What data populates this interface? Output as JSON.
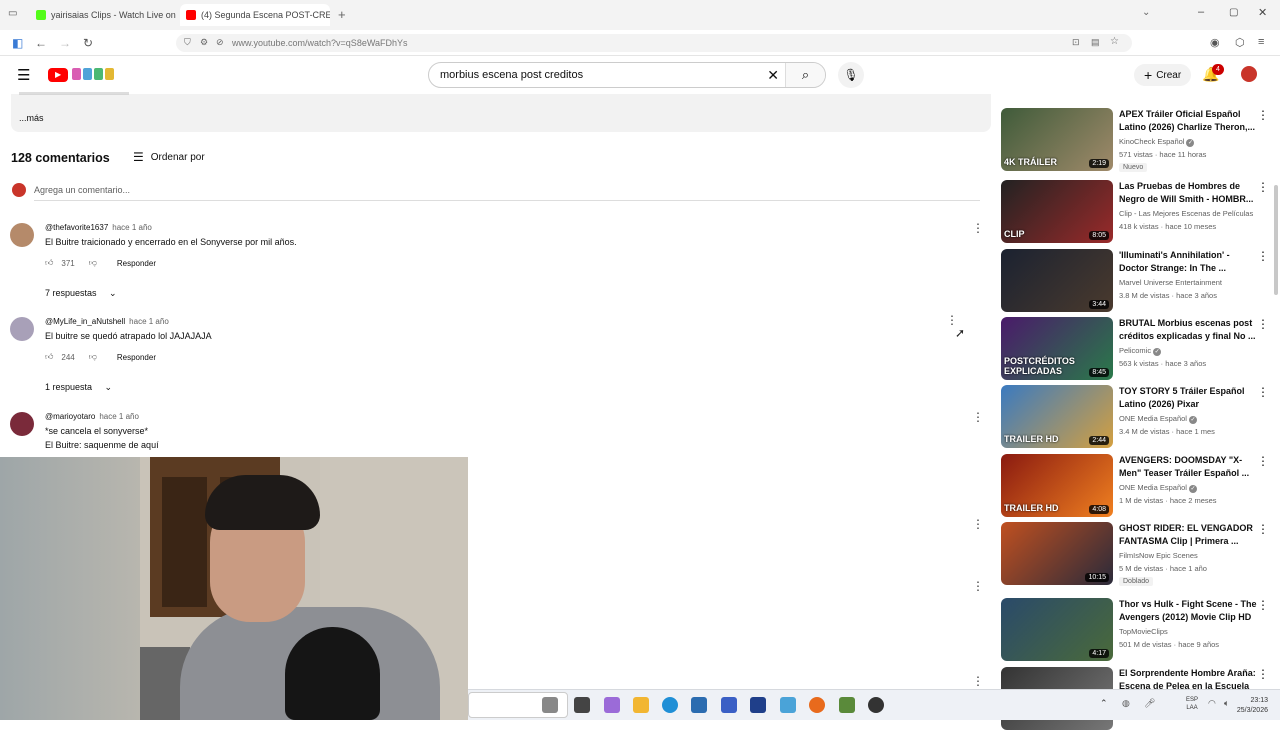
{
  "browser": {
    "tabs": [
      {
        "title": "yairisaias Clips - Watch Live on",
        "active": false,
        "favicon_color": "#53fc18"
      },
      {
        "title": "(4) Segunda Escena POST-CRED",
        "active": true,
        "favicon_color": "#ff0000"
      }
    ],
    "url": "www.youtube.com/watch?v=qS8eWaFDhYs"
  },
  "youtube": {
    "search_query": "morbius escena post creditos",
    "create_label": "Crear",
    "notifications_count": "4"
  },
  "description": {
    "more_label": "...más"
  },
  "comments_header": {
    "count_label": "128 comentarios",
    "sort_label": "Ordenar por",
    "add_placeholder": "Agrega un comentario..."
  },
  "comments": [
    {
      "handle": "@thefavorite1637",
      "ago": "hace 1 año",
      "text": "El Buitre traicionado y encerrado en el Sonyverse por mil años.",
      "likes": "371",
      "reply_label": "Responder",
      "replies_label": "7 respuestas"
    },
    {
      "handle": "@MyLife_in_aNutshell",
      "ago": "hace 1 año",
      "text": "El buitre se quedó atrapado lol JAJAJAJA",
      "likes": "244",
      "reply_label": "Responder",
      "replies_label": "1 respuesta"
    },
    {
      "handle": "@marioyotaro",
      "ago": "hace 1 año",
      "text": "*se cancela el sonyverse*",
      "text2": "El Buitre: saquenme de aquí"
    }
  ],
  "sidebar": [
    {
      "title": "APEX Tráiler Oficial Español Latino (2026) Charlize Theron,...",
      "channel": "KinoCheck Español",
      "verified": true,
      "meta": "571 vistas · hace 11 horas",
      "badge": "Nuevo",
      "duration": "2:19",
      "tag": "4K TRÁILER",
      "colors": [
        "#3f5b3a",
        "#a08a6a"
      ]
    },
    {
      "title": "Las Pruebas de Hombres de Negro de Will Smith - HOMBR...",
      "channel": "Clip - Las Mejores Escenas de Películas",
      "verified": false,
      "meta": "418 k vistas · hace 10 meses",
      "badge": "",
      "duration": "8:05",
      "tag": "CLIP",
      "colors": [
        "#222",
        "#9a2a2a"
      ]
    },
    {
      "title": "'Illuminati's Annihilation' - Doctor Strange: In The ...",
      "channel": "Marvel Universe Entertainment",
      "verified": false,
      "meta": "3.8 M de vistas · hace 3 años",
      "badge": "",
      "duration": "3:44",
      "tag": "",
      "colors": [
        "#1b2230",
        "#4a3a2e"
      ]
    },
    {
      "title": "BRUTAL Morbius escenas post créditos explicadas y final No ...",
      "channel": "Pelicomic",
      "verified": true,
      "meta": "563 k vistas · hace 3 años",
      "badge": "",
      "duration": "8:45",
      "tag": "POSTCRÉDITOS EXPLICADAS",
      "colors": [
        "#4a1a6a",
        "#2a7a4a"
      ]
    },
    {
      "title": "TOY STORY 5 Tráiler Español Latino (2026) Pixar",
      "channel": "ONE Media Español",
      "verified": true,
      "meta": "3.4 M de vistas · hace 1 mes",
      "badge": "",
      "duration": "2:44",
      "tag": "TRAILER HD",
      "colors": [
        "#3a7ac0",
        "#d4a040"
      ]
    },
    {
      "title": "AVENGERS: DOOMSDAY \"X-Men\" Teaser Tráiler Español ...",
      "channel": "ONE Media Español",
      "verified": true,
      "meta": "1 M de vistas · hace 2 meses",
      "badge": "",
      "duration": "4:08",
      "tag": "TRAILER HD",
      "colors": [
        "#8a1a10",
        "#f08020"
      ]
    },
    {
      "title": "GHOST RIDER: EL VENGADOR FANTASMA Clip | Primera ...",
      "channel": "FilmIsNow Epic Scenes",
      "verified": false,
      "meta": "5 M de vistas · hace 1 año",
      "badge": "Doblado",
      "duration": "10:15",
      "tag": "",
      "colors": [
        "#c05020",
        "#2a2a3a"
      ]
    },
    {
      "title": "Thor vs Hulk - Fight Scene - The Avengers (2012) Movie Clip HD",
      "channel": "TopMovieClips",
      "verified": false,
      "meta": "501 M de vistas · hace 9 años",
      "badge": "",
      "duration": "4:17",
      "tag": "",
      "colors": [
        "#2a4a6a",
        "#4a6a3a"
      ]
    },
    {
      "title": "El Sorprendente Hombre Araña: Escena de Pelea en la Escuela",
      "channel": "",
      "verified": false,
      "meta": "",
      "badge": "",
      "duration": "",
      "tag": "",
      "colors": [
        "#333",
        "#777"
      ]
    }
  ],
  "taskbar": {
    "lang_top": "ESP",
    "lang_bottom": "LAA",
    "time": "23:13",
    "date": "25/3/2026"
  }
}
